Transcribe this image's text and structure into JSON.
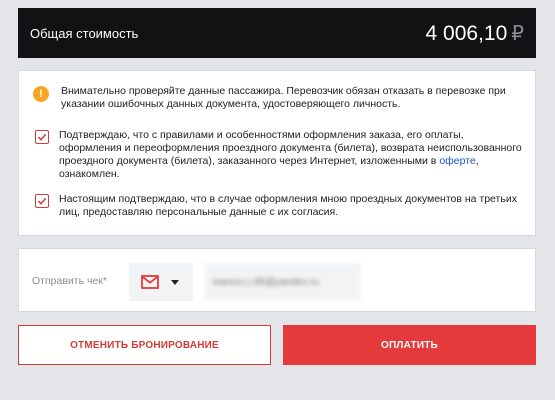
{
  "total": {
    "label": "Общая стоимость",
    "amount": "4 006,10",
    "currency": "₽"
  },
  "notice": {
    "warning_icon": "exclamation-circle-icon",
    "warning_text": "Внимательно проверяйте данные пассажира. Перевозчик обязан отказать в перевозке при указании ошибочных данных документа, удостоверяющего личность.",
    "rules_text_before": "Подтверждаю, что с правилами и особенностями оформления заказа, его оплаты, оформления и переоформления проездного документа (билета), возврата неиспользованного проездного документа (билета), заказанного через Интернет, изложенными в ",
    "rules_link": "оферте",
    "rules_text_after": ", ознакомлен.",
    "rules_checked": true,
    "consent_text": "Настоящим подтверждаю, что в случае оформления мною проездных документов на третьих лиц, предоставляю персональные данные с их согласия.",
    "consent_checked": true
  },
  "receipt": {
    "label": "Отправить чек*",
    "channel_icon": "mail-icon",
    "email_value": "ivanov.i.i.95@yandex.ru"
  },
  "actions": {
    "cancel_label": "ОТМЕНИТЬ БРОНИРОВАНИЕ",
    "pay_label": "ОПЛАТИТЬ"
  },
  "colors": {
    "accent": "#e53a3c",
    "warning": "#f6a623",
    "dark_bar": "#111214",
    "link": "#1a56c7"
  }
}
